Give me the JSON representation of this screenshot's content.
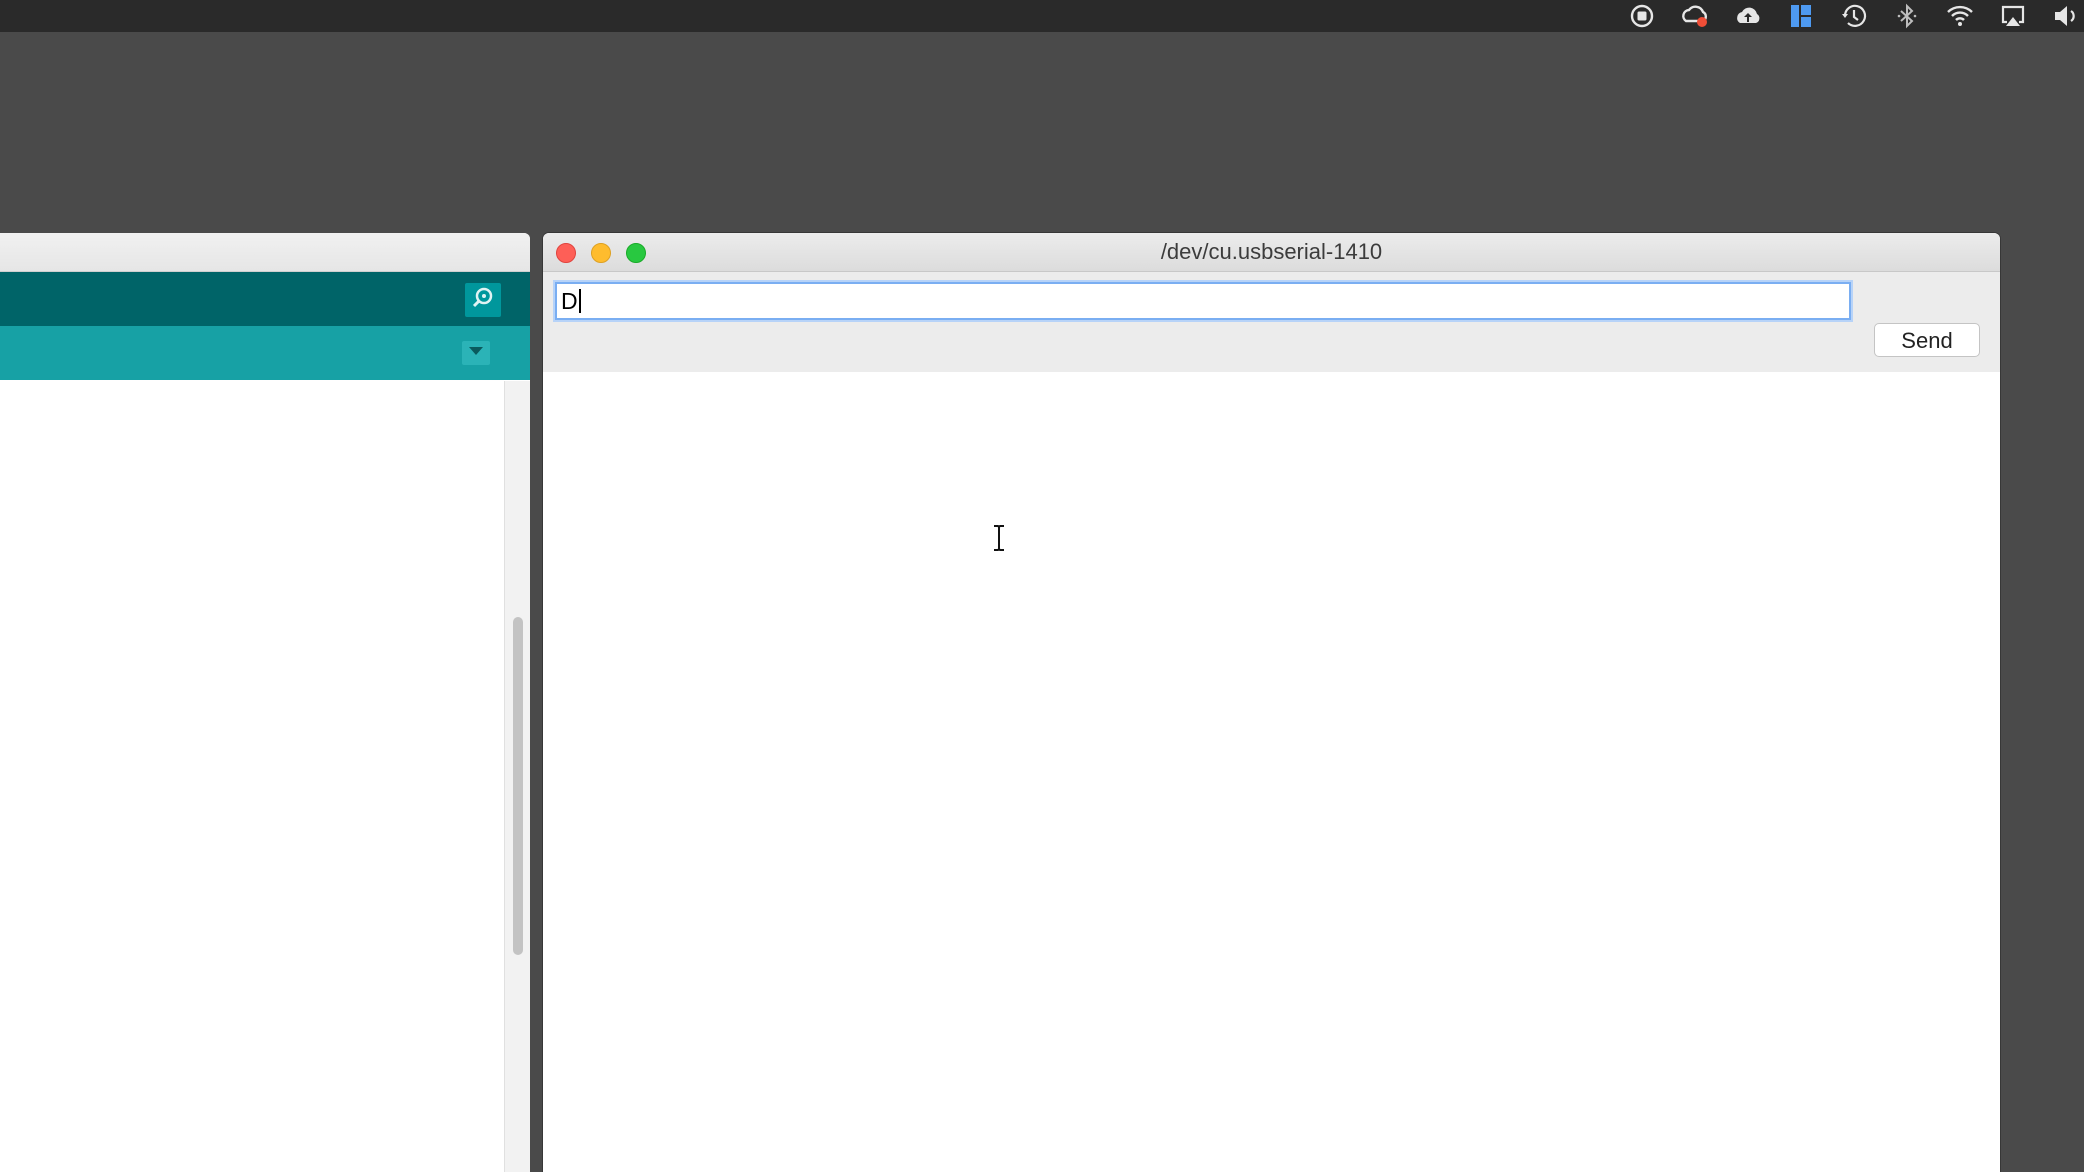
{
  "menubar": {
    "icons": [
      "screen-record-icon",
      "creative-cloud-icon",
      "cloud-upload-icon",
      "layout-app-icon",
      "time-machine-icon",
      "bluetooth-icon",
      "wifi-icon",
      "airplay-icon",
      "volume-icon"
    ]
  },
  "ide": {
    "toolbar": {
      "serial_monitor_icon": "magnifier-icon"
    },
    "tabbar": {
      "menu_icon": "chevron-down-icon"
    }
  },
  "serial_monitor": {
    "title": "/dev/cu.usbserial-1410",
    "input_value": "D",
    "send_label": "Send"
  },
  "colors": {
    "toolbar": "#006468",
    "tabbar": "#17a1a5",
    "input_focus": "#7aaef2"
  }
}
